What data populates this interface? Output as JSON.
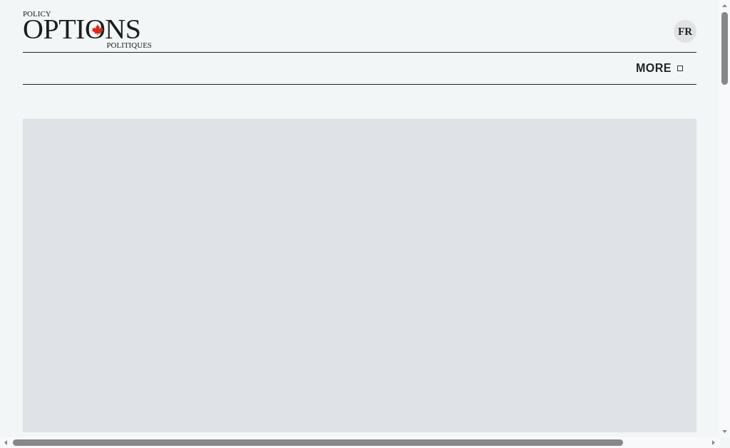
{
  "logo": {
    "top": "POLICY",
    "main": "OPTIONS",
    "bottom": "POLITIQUES"
  },
  "language_button": "FR",
  "nav": {
    "more": "MORE"
  },
  "hero": {
    "kind": "placeholder"
  }
}
